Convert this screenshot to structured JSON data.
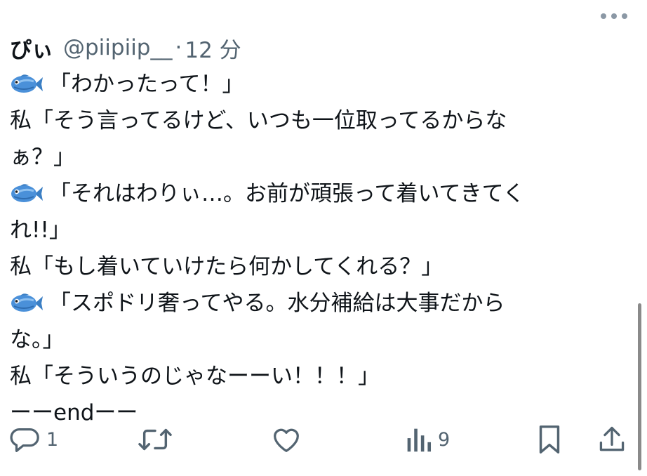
{
  "tweet": {
    "author": {
      "display_name": "ぴぃ",
      "handle": "@piipiip__",
      "separator": "·",
      "time": "12 分"
    },
    "lines": [
      {
        "fish": true,
        "text": "「わかったって！」"
      },
      {
        "fish": false,
        "text": "私「そう言ってるけど、いつも一位取ってるからな"
      },
      {
        "fish": false,
        "text": "ぁ？」"
      },
      {
        "fish": true,
        "text": "「それはわりぃ…。お前が頑張って着いてきてく"
      },
      {
        "fish": false,
        "text": "れ!!」"
      },
      {
        "fish": false,
        "text": "私「もし着いていけたら何かしてくれる？」"
      },
      {
        "fish": true,
        "text": "「スポドリ奢ってやる。水分補給は大事だから"
      },
      {
        "fish": false,
        "text": "な。」"
      },
      {
        "fish": false,
        "text": "私「そういうのじゃなーーい！！！」"
      },
      {
        "fish": false,
        "text": "ーーendーー"
      }
    ],
    "actions": {
      "reply_count": "1",
      "views_count": "9"
    }
  },
  "icons": {
    "fish": "tropical-fish-emoji",
    "reply": "reply-icon",
    "retweet": "retweet-icon",
    "like": "heart-icon",
    "views": "views-icon",
    "bookmark": "bookmark-icon",
    "share": "share-icon",
    "more": "more-icon"
  },
  "colors": {
    "text": "#0f1419",
    "secondary": "#536471",
    "fish_body": "#4a90d9"
  }
}
